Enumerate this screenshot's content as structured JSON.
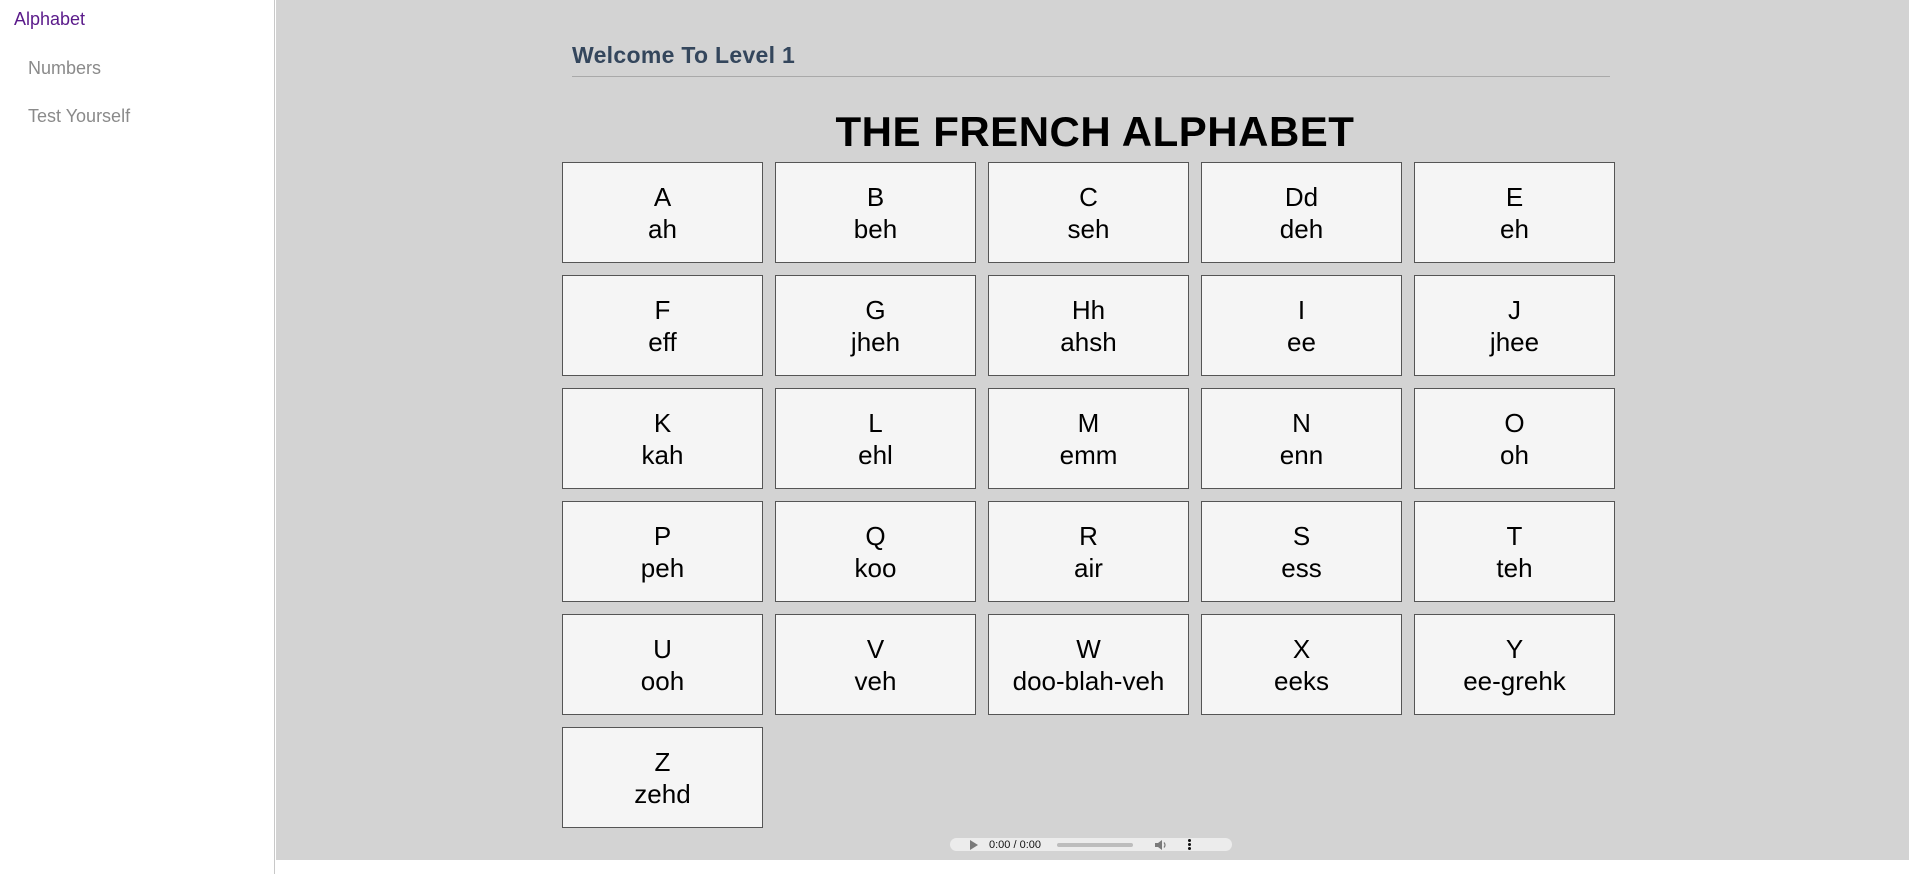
{
  "sidebar": {
    "active": "Alphabet",
    "items": [
      "Numbers",
      "Test Yourself"
    ]
  },
  "header": {
    "welcome": "Welcome To Level 1"
  },
  "title": "THE FRENCH ALPHABET",
  "letters": [
    {
      "letter": "A",
      "sound": "ah"
    },
    {
      "letter": "B",
      "sound": "beh"
    },
    {
      "letter": "C",
      "sound": "seh"
    },
    {
      "letter": "Dd",
      "sound": "deh"
    },
    {
      "letter": "E",
      "sound": "eh"
    },
    {
      "letter": "F",
      "sound": "eff"
    },
    {
      "letter": "G",
      "sound": "jheh"
    },
    {
      "letter": "Hh",
      "sound": "ahsh"
    },
    {
      "letter": "I",
      "sound": "ee"
    },
    {
      "letter": "J",
      "sound": "jhee"
    },
    {
      "letter": "K",
      "sound": "kah"
    },
    {
      "letter": "L",
      "sound": "ehl"
    },
    {
      "letter": "M",
      "sound": "emm"
    },
    {
      "letter": "N",
      "sound": "enn"
    },
    {
      "letter": "O",
      "sound": "oh"
    },
    {
      "letter": "P",
      "sound": "peh"
    },
    {
      "letter": "Q",
      "sound": "koo"
    },
    {
      "letter": "R",
      "sound": "air"
    },
    {
      "letter": "S",
      "sound": "ess"
    },
    {
      "letter": "T",
      "sound": "teh"
    },
    {
      "letter": "U",
      "sound": "ooh"
    },
    {
      "letter": "V",
      "sound": "veh"
    },
    {
      "letter": "W",
      "sound": "doo-blah-veh"
    },
    {
      "letter": "X",
      "sound": "eeks"
    },
    {
      "letter": "Y",
      "sound": "ee-grehk"
    },
    {
      "letter": "Z",
      "sound": "zehd"
    }
  ],
  "audio": {
    "time": "0:00 / 0:00",
    "icons": [
      "play-icon",
      "volume-icon",
      "more-options-icon"
    ]
  }
}
